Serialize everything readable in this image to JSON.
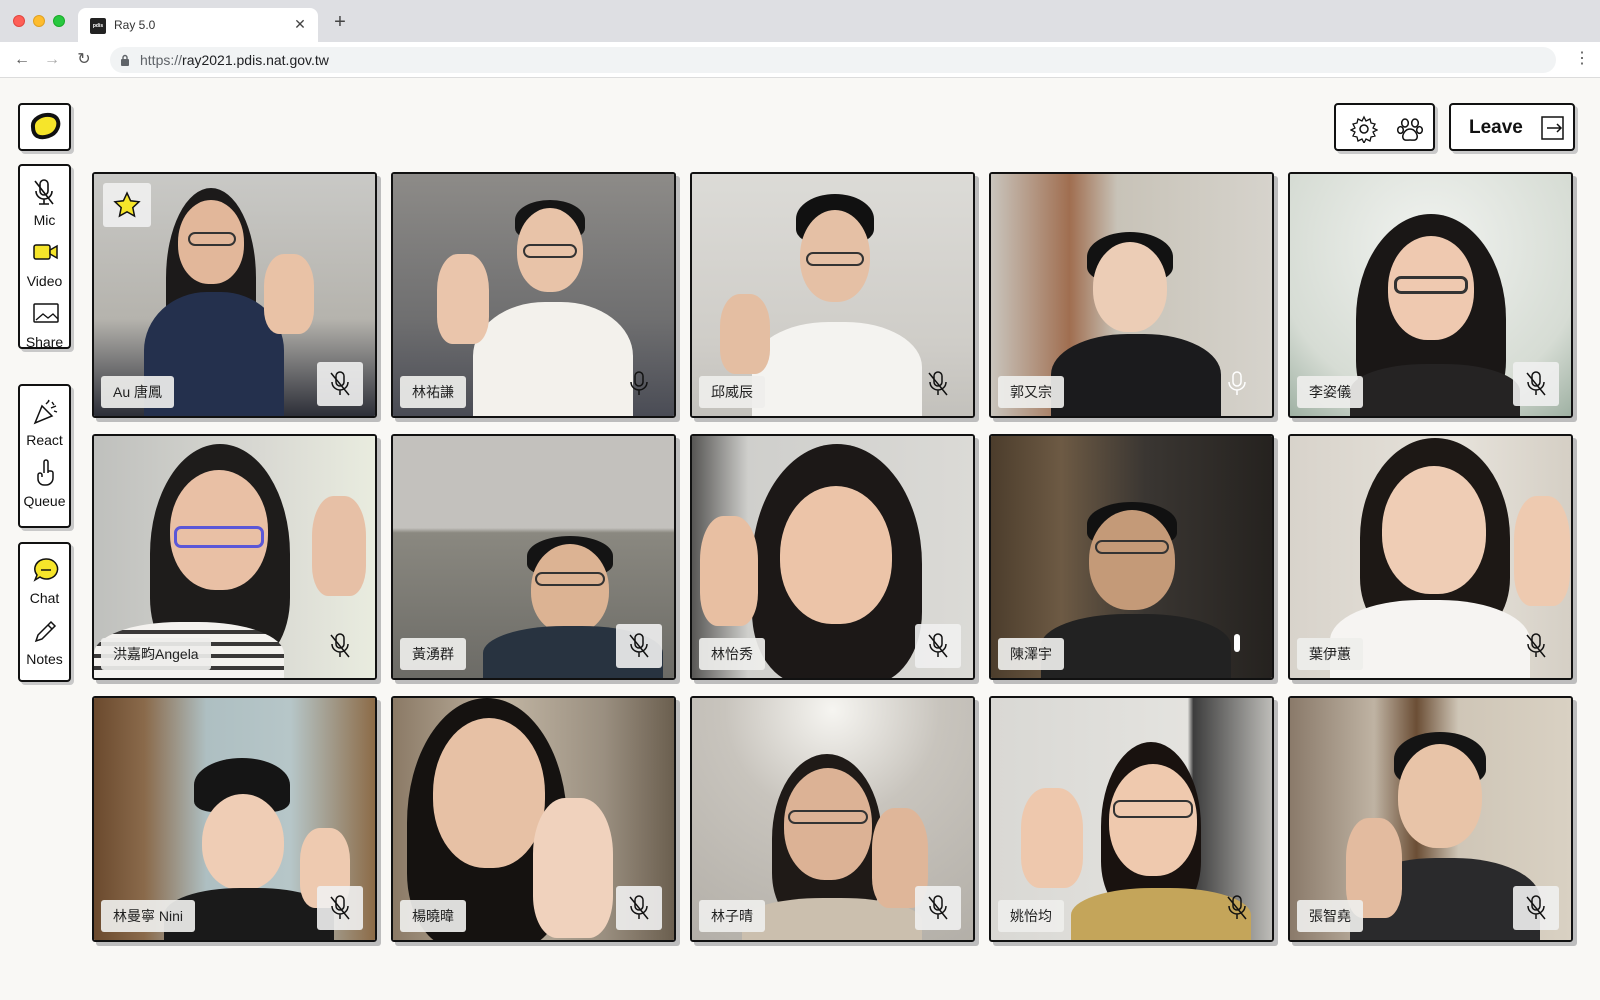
{
  "browser": {
    "tab_title": "Ray 5.0",
    "tab_favicon_text": "pdis",
    "url_scheme": "https://",
    "url_host": "ray2021.pdis.nat.gov.tw"
  },
  "sidebar": {
    "groups": [
      [
        {
          "label": "Mic",
          "icon": "mic-off-icon"
        },
        {
          "label": "Video",
          "icon": "video-icon"
        },
        {
          "label": "Share",
          "icon": "share-screen-icon"
        }
      ],
      [
        {
          "label": "React",
          "icon": "party-popper-icon"
        },
        {
          "label": "Queue",
          "icon": "raise-hand-icon"
        }
      ],
      [
        {
          "label": "Chat",
          "icon": "chat-icon"
        },
        {
          "label": "Notes",
          "icon": "pencil-icon"
        }
      ]
    ]
  },
  "header": {
    "leave_label": "Leave",
    "settings_icon": "gear-icon",
    "paw_icon": "paw-icon",
    "exit_icon": "exit-icon"
  },
  "colors": {
    "accent_yellow": "#f6e52a",
    "border": "#111111",
    "background": "#f9f8f5"
  },
  "participants": [
    {
      "name": "Au 唐鳳",
      "host": true
    },
    {
      "name": "林祐謙"
    },
    {
      "name": "邱威辰"
    },
    {
      "name": "郭又宗"
    },
    {
      "name": "李姿儀"
    },
    {
      "name": "洪嘉畇Angela"
    },
    {
      "name": "黃湧群"
    },
    {
      "name": "林怡秀"
    },
    {
      "name": "陳澤宇"
    },
    {
      "name": "葉伊蕙"
    },
    {
      "name": "林曼寧 Nini"
    },
    {
      "name": "楊曉暐"
    },
    {
      "name": "林子晴"
    },
    {
      "name": "姚怡均"
    },
    {
      "name": "張智堯"
    }
  ]
}
